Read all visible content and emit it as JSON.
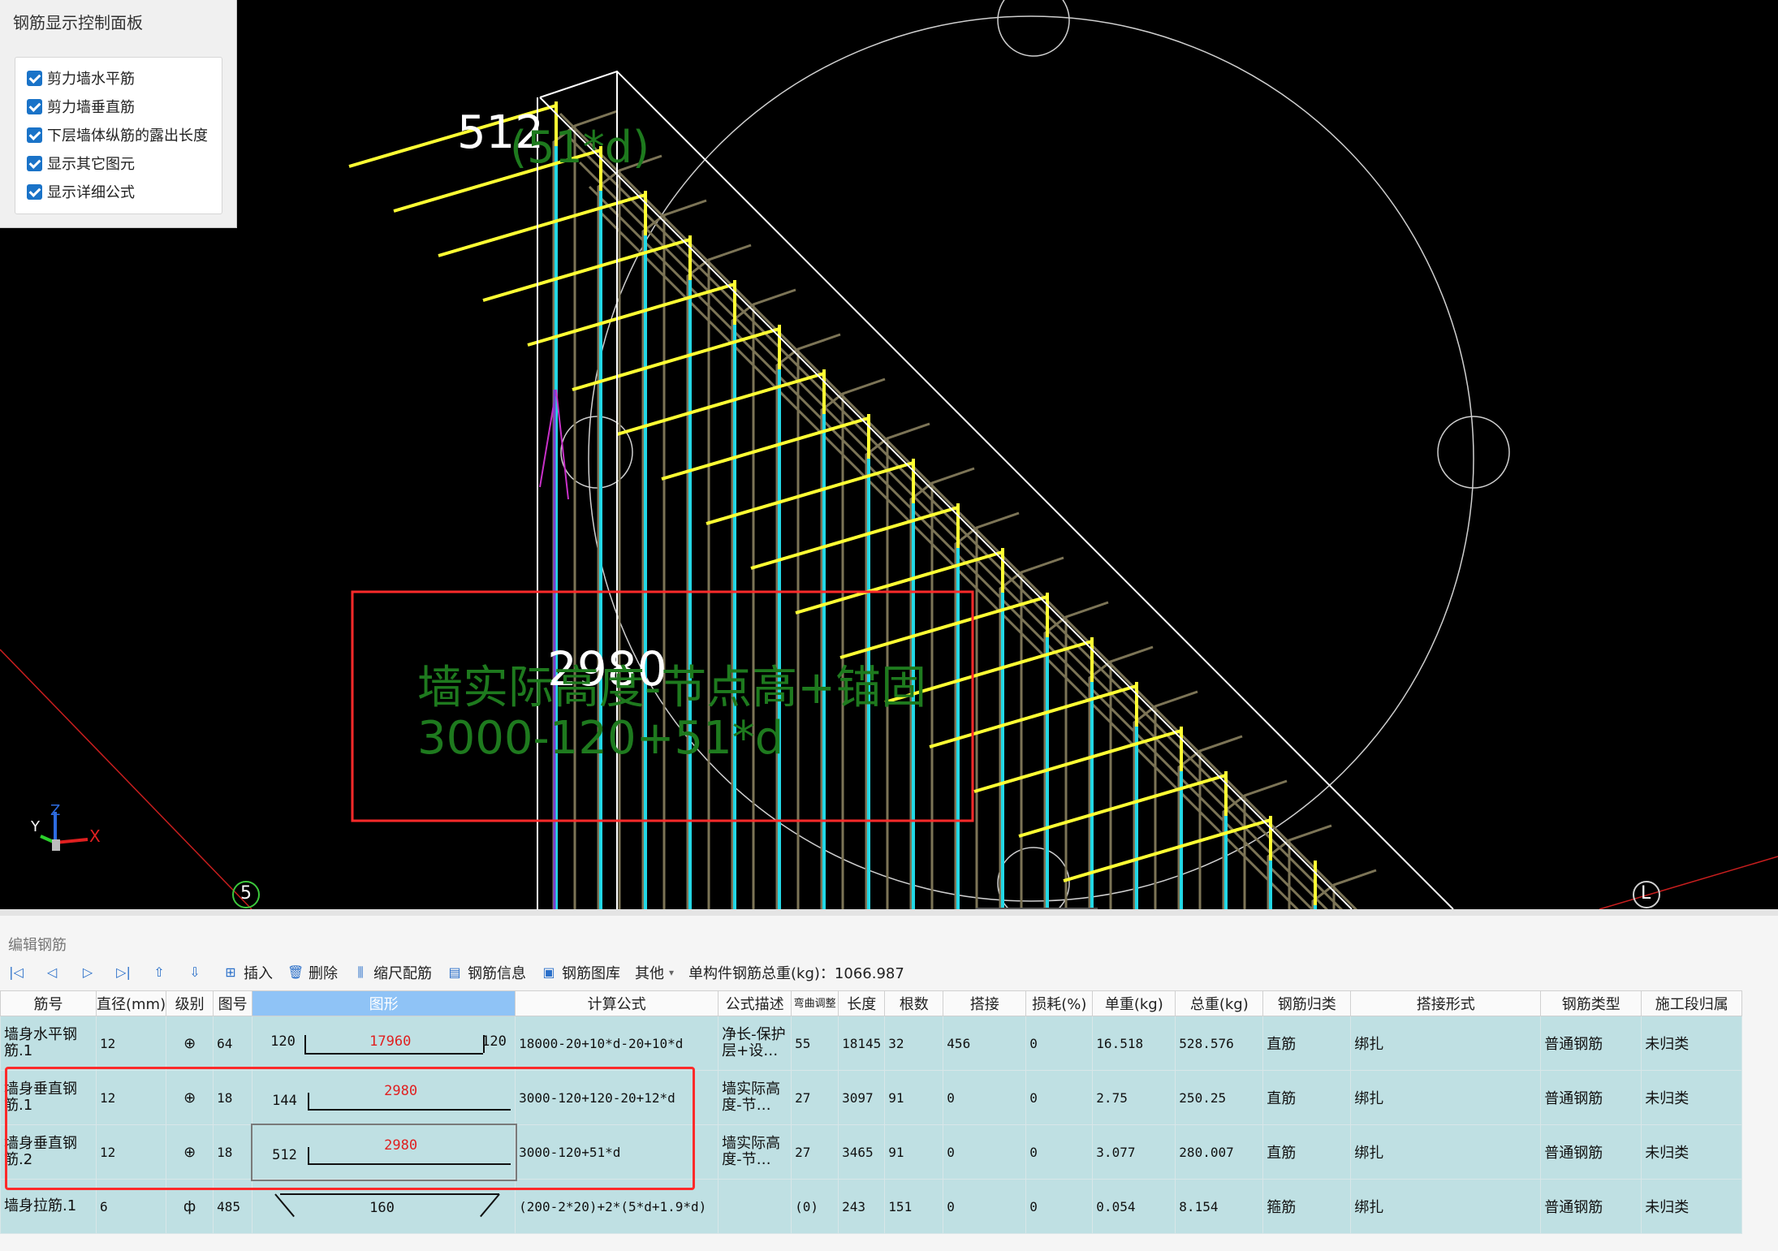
{
  "control_panel": {
    "title": "钢筋显示控制面板",
    "options": [
      {
        "label": "剪力墙水平筋",
        "checked": true
      },
      {
        "label": "剪力墙垂直筋",
        "checked": true
      },
      {
        "label": "下层墙体纵筋的露出长度",
        "checked": true
      },
      {
        "label": "显示其它图元",
        "checked": true
      },
      {
        "label": "显示详细公式",
        "checked": true
      }
    ]
  },
  "viewport": {
    "top_label": "512",
    "top_formula": "(51*d)",
    "center_label": "2980",
    "formula_line1": "墙实际高度-节点高+锚固",
    "formula_line2": "3000-120+51*d",
    "axis_left": "5",
    "axis_right": "L",
    "gizmo_x": "X",
    "gizmo_y": "Y",
    "gizmo_z": "Z",
    "colors": {
      "horizontal": "#ffff33",
      "vertical": "#22d8e6",
      "body": "#7c7456",
      "highlight": "#ff2a2a",
      "formula": "#1e7a1e"
    }
  },
  "editor": {
    "panel_title": "编辑钢筋",
    "toolbar": {
      "insert": "插入",
      "delete": "删除",
      "scale": "缩尺配筋",
      "info": "钢筋信息",
      "library": "钢筋图库",
      "other": "其他",
      "total_label": "单构件钢筋总重(kg)：1066.987"
    },
    "columns": [
      "筋号",
      "直径(mm)",
      "级别",
      "图号",
      "图形",
      "计算公式",
      "公式描述",
      "弯曲调整",
      "长度",
      "根数",
      "搭接",
      "损耗(%)",
      "单重(kg)",
      "总重(kg)",
      "钢筋归类",
      "搭接形式",
      "钢筋类型",
      "施工段归属"
    ],
    "rows": [
      {
        "idx": "1",
        "name": "墙身水平钢筋.1",
        "dia": "12",
        "grade": "⊕",
        "fig": "64",
        "shape_left": "120",
        "shape_mid": "17960",
        "shape_right": "120",
        "formula": "18000-20+10*d-20+10*d",
        "desc": "净长-保护层+设…",
        "bend": "55",
        "length": "18145",
        "count": "32",
        "lap": "456",
        "loss": "0",
        "unit_w": "16.518",
        "total_w": "528.576",
        "cat": "直筋",
        "lap_type": "绑扎",
        "type": "普通钢筋",
        "stage": "未归类"
      },
      {
        "idx": "2",
        "name": "墙身垂直钢筋.1",
        "dia": "12",
        "grade": "⊕",
        "fig": "18",
        "shape_left": "144",
        "shape_mid": "2980",
        "shape_right": "",
        "formula": "3000-120+120-20+12*d",
        "desc": "墙实际高度-节…",
        "bend": "27",
        "length": "3097",
        "count": "91",
        "lap": "0",
        "loss": "0",
        "unit_w": "2.75",
        "total_w": "250.25",
        "cat": "直筋",
        "lap_type": "绑扎",
        "type": "普通钢筋",
        "stage": "未归类"
      },
      {
        "idx": "3",
        "name": "墙身垂直钢筋.2",
        "dia": "12",
        "grade": "⊕",
        "fig": "18",
        "shape_left": "512",
        "shape_mid": "2980",
        "shape_right": "",
        "formula": "3000-120+51*d",
        "desc": "墙实际高度-节…",
        "bend": "27",
        "length": "3465",
        "count": "91",
        "lap": "0",
        "loss": "0",
        "unit_w": "3.077",
        "total_w": "280.007",
        "cat": "直筋",
        "lap_type": "绑扎",
        "type": "普通钢筋",
        "stage": "未归类"
      },
      {
        "idx": "4",
        "name": "墙身拉筋.1",
        "dia": "6",
        "grade": "ф",
        "fig": "485",
        "shape_left": "",
        "shape_mid": "160",
        "shape_right": "",
        "formula": "(200-2*20)+2*(5*d+1.9*d)",
        "desc": "",
        "bend": "(0)",
        "length": "243",
        "count": "151",
        "lap": "0",
        "loss": "0",
        "unit_w": "0.054",
        "total_w": "8.154",
        "cat": "箍筋",
        "lap_type": "绑扎",
        "type": "普通钢筋",
        "stage": "未归类"
      }
    ]
  }
}
